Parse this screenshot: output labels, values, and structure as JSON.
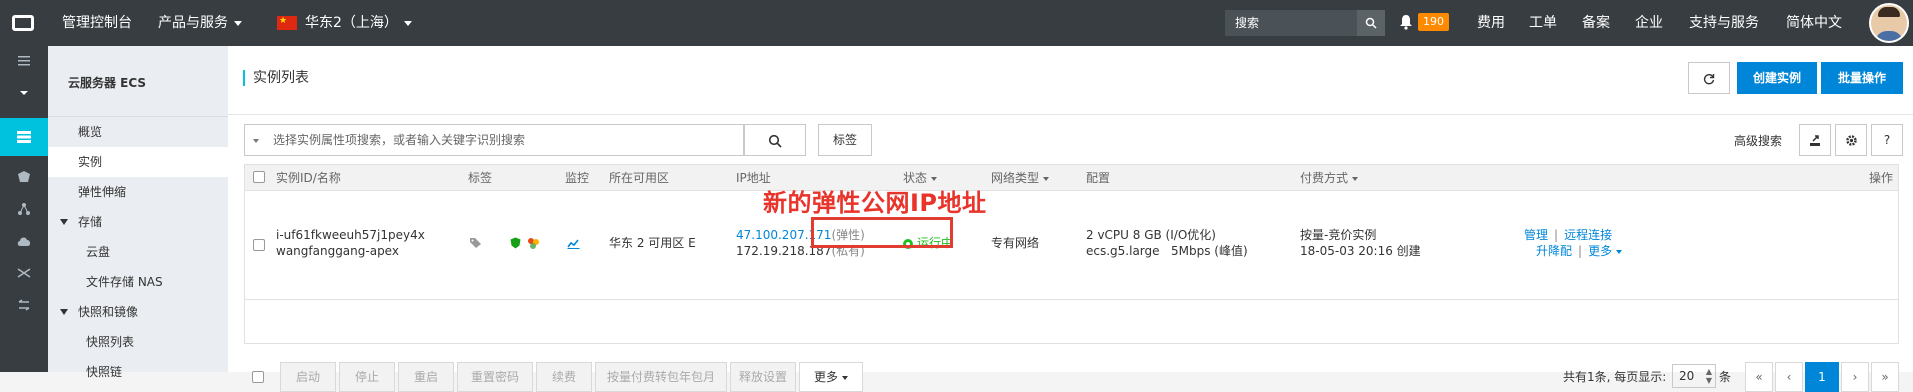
{
  "topbar": {
    "console": "管理控制台",
    "products": "产品与服务",
    "region": "华东2（上海）",
    "search_placeholder": "搜索",
    "notifications": "190",
    "links": [
      "费用",
      "工单",
      "备案",
      "企业",
      "支持与服务",
      "简体中文"
    ]
  },
  "sidebar": {
    "title": "云服务器 ECS",
    "items": [
      {
        "label": "概览"
      },
      {
        "label": "实例"
      },
      {
        "label": "弹性伸缩"
      },
      {
        "label": "存储"
      },
      {
        "label": "云盘"
      },
      {
        "label": "文件存储 NAS"
      },
      {
        "label": "快照和镜像"
      },
      {
        "label": "快照列表"
      },
      {
        "label": "快照链"
      }
    ]
  },
  "main": {
    "title": "实例列表",
    "create_label": "创建实例",
    "batch_label": "批量操作",
    "filter_placeholder": "选择实例属性项搜索，或者输入关键字识别搜索",
    "tag_label": "标签",
    "advanced_search": "高级搜索",
    "help": "?"
  },
  "table": {
    "headers": [
      "实例ID/名称",
      "标签",
      "监控",
      "所在可用区",
      "IP地址",
      "状态",
      "网络类型",
      "配置",
      "付费方式",
      "操作"
    ],
    "row": {
      "id": "i-uf61fkweeuh57j1pey4x",
      "name": "wangfanggang-apex",
      "zone": "华东 2 可用区 E",
      "ip_public": "47.100.207.171",
      "ip_public_tag": "(弹性)",
      "ip_private": "172.19.218.187",
      "ip_private_tag": "(私有)",
      "status": "运行中",
      "network": "专有网络",
      "config_line1": "2 vCPU 8 GB (I/O优化)",
      "config_line2": "ecs.g5.large   5Mbps (峰值)",
      "billing_line1": "按量-竞价实例",
      "billing_line2": "18-05-03 20:16 创建",
      "actions": [
        "管理",
        "远程连接",
        "升降配",
        "更多"
      ]
    }
  },
  "annotation": "新的弹性公网IP地址",
  "footer": {
    "buttons": [
      "启动",
      "停止",
      "重启",
      "重置密码",
      "续费",
      "按量付费转包年包月",
      "释放设置",
      "更多"
    ],
    "summary": "共有1条, 每页显示:",
    "page_size": "20",
    "page_unit": "条",
    "pager": [
      "«",
      "‹",
      "1",
      "›",
      "»"
    ]
  },
  "colors": {
    "accent": "#0086d9",
    "topbar": "#373d41",
    "highlight": "#00c1de",
    "annotation": "#e03c31"
  }
}
